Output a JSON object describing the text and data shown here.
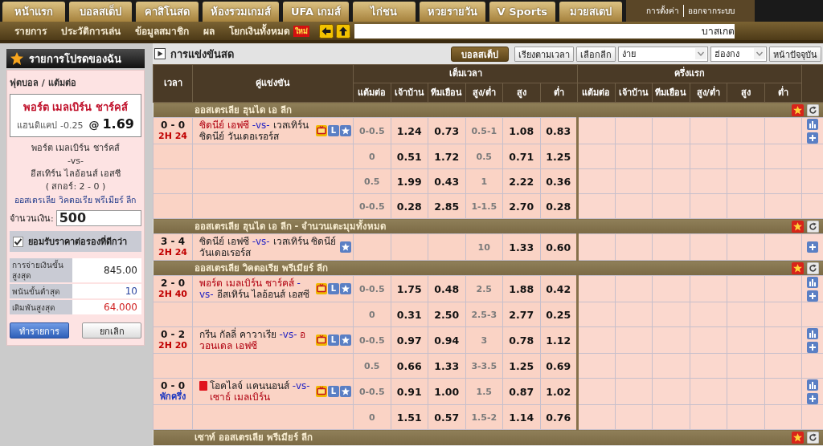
{
  "top_nav": {
    "tabs": [
      "หน้าแรก",
      "บอลสเต็ป",
      "คาสิโนสด",
      "ห้องรวมเกมส์",
      "UFA เกมส์",
      "ไก่ชน",
      "หวยรายวัน",
      "V Sports",
      "มวยสเตป"
    ],
    "account_links": [
      "การตั้งค่า",
      "ออกจากระบบ"
    ]
  },
  "sub_nav": {
    "links": [
      {
        "label": "รายการ"
      },
      {
        "label": "ประวัติการเล่น"
      },
      {
        "label": "ข้อมูลสมาชิก"
      },
      {
        "label": "ผล"
      },
      {
        "label": "โยกเงินทั้งหมด",
        "badge": "ใหม่"
      }
    ],
    "ticker": "บาสเกต"
  },
  "bet_slip": {
    "title": "รายการโปรดของฉัน",
    "sport": "ฟุตบอล / แต้มต่อ",
    "pick": {
      "team": "พอร์ต เมลเบิร์น ชาร์คส์",
      "market": "แฮนดิแคป",
      "line": "-0.25",
      "at": "@",
      "odds": "1.69"
    },
    "home": "พอร์ต เมลเบิร์น ชาร์คส์",
    "vs": "-vs-",
    "away": "อีสเทิร์น ไลอ้อนส์ เอสซี",
    "score": "( สกอร์: 2 - 0 )",
    "league": "ออสเตรเลีย วิคตอเรีย พรีเมียร์ ลีก",
    "amount": {
      "label": "จำนวนเงิน:",
      "value": "500"
    },
    "accept_better_odds": {
      "label": "ยอมรับราคาต่อรองที่ดีกว่า",
      "checked": true
    },
    "limits": [
      {
        "kind": "payout",
        "label": "การจ่ายเงินขั้นสูงสุด",
        "value": "845.00"
      },
      {
        "kind": "min",
        "label": "พนันขั้นต่ำสุด",
        "value": "10"
      },
      {
        "kind": "max",
        "label": "เดิมพันสูงสุด",
        "value": "64.000"
      }
    ],
    "buttons": [
      {
        "kind": "primary",
        "label": "ทำรายการ"
      },
      {
        "kind": "secondary",
        "label": "ยกเลิก"
      }
    ]
  },
  "live": {
    "title": "การแข่งขันสด",
    "toolbar": [
      {
        "kind": "toggle",
        "label": "บอลสเต็ป",
        "selected": true
      },
      {
        "kind": "button",
        "label": "เรียงตามเวลา"
      },
      {
        "kind": "button",
        "label": "เลือกลีก"
      },
      {
        "kind": "select",
        "value": "ง่าย"
      },
      {
        "kind": "select",
        "value": "ฮ่องกง"
      },
      {
        "kind": "button",
        "label": "หน้าปัจจุบัน"
      }
    ],
    "table": {
      "header": {
        "time": "เวลา",
        "match": "คู่แข่งขัน",
        "groups": [
          {
            "label": "เต็มเวลา",
            "columns": [
              "แต้มต่อ",
              "เจ้าบ้าน",
              "ทีมเยือน",
              "สูง/ต่ำ",
              "สูง",
              "ต่ำ"
            ]
          },
          {
            "label": "ครึ่งแรก",
            "columns": [
              "แต้มต่อ",
              "เจ้าบ้าน",
              "ทีมเยือน",
              "สูง/ต่ำ",
              "สูง",
              "ต่ำ"
            ]
          }
        ]
      },
      "leagues": [
        {
          "name": "ออสเตรเลีย ฮุนได เอ ลีก",
          "matches": [
            {
              "score": "0 - 0",
              "clock": {
                "kind": "running",
                "text": "2H 24"
              },
              "red_card": false,
              "home": {
                "name": "ซิดนีย์ เอฟซี",
                "favorite": true
              },
              "vs": "-vs-",
              "away": {
                "name": "เวสเทิร์น ซิดนีย์ วันเดอเรอร์ส",
                "favorite": false
              },
              "markers": [
                {
                  "kind": "tv"
                },
                {
                  "kind": "live",
                  "text": "L"
                },
                {
                  "kind": "star"
                }
              ],
              "lines": [
                {
                  "hdp": "0-0.5",
                  "odds_home": "1.24",
                  "odds_away": "0.73",
                  "ou": "0.5-1",
                  "over": "1.08",
                  "under": "0.83",
                  "tools": [
                    {
                      "kind": "stats"
                    },
                    {
                      "kind": "add"
                    }
                  ]
                },
                {
                  "hdp": "0",
                  "odds_home": "0.51",
                  "odds_away": "1.72",
                  "ou": "0.5",
                  "over": "0.71",
                  "under": "1.25"
                },
                {
                  "hdp": "0.5",
                  "odds_home": "1.99",
                  "odds_away": "0.43",
                  "ou": "1",
                  "over": "2.22",
                  "under": "0.36"
                },
                {
                  "hdp": "0-0.5",
                  "odds_home": "0.28",
                  "odds_away": "2.85",
                  "ou": "1-1.5",
                  "over": "2.70",
                  "under": "0.28"
                }
              ]
            }
          ]
        },
        {
          "name": "ออสเตรเลีย ฮุนได เอ ลีก - จำนวนเตะมุมทั้งหมด",
          "matches": [
            {
              "score": "3 - 4",
              "clock": {
                "kind": "running",
                "text": "2H 24"
              },
              "red_card": false,
              "home": {
                "name": "ซิดนีย์ เอฟซี",
                "favorite": false
              },
              "vs": "-vs-",
              "away": {
                "name": "เวสเทิร์น ซิดนีย์ วันเดอเรอร์ส",
                "favorite": false
              },
              "markers": [
                {
                  "kind": "star"
                }
              ],
              "lines": [
                {
                  "ou": "10",
                  "over": "1.33",
                  "under": "0.60",
                  "tools": [
                    {
                      "kind": "add"
                    }
                  ]
                }
              ]
            }
          ]
        },
        {
          "name": "ออสเตรเลีย วิคตอเรีย พรีเมียร์ ลีก",
          "matches": [
            {
              "score": "2 - 0",
              "clock": {
                "kind": "running",
                "text": "2H 40"
              },
              "red_card": false,
              "home": {
                "name": "พอร์ต เมลเบิร์น ชาร์คส์",
                "favorite": true
              },
              "vs": "-vs-",
              "away": {
                "name": "อีสเทิร์น ไลอ้อนส์ เอสซี",
                "favorite": false
              },
              "markers": [
                {
                  "kind": "tv"
                },
                {
                  "kind": "live",
                  "text": "L"
                },
                {
                  "kind": "star"
                }
              ],
              "lines": [
                {
                  "hdp": "0-0.5",
                  "odds_home": "1.75",
                  "odds_away": "0.48",
                  "ou": "2.5",
                  "over": "1.88",
                  "under": "0.42",
                  "tools": [
                    {
                      "kind": "stats"
                    },
                    {
                      "kind": "add"
                    }
                  ]
                },
                {
                  "hdp": "0",
                  "odds_home": "0.31",
                  "odds_away": "2.50",
                  "ou": "2.5-3",
                  "over": "2.77",
                  "under": "0.25"
                }
              ]
            },
            {
              "score": "0 - 2",
              "clock": {
                "kind": "running",
                "text": "2H 20"
              },
              "red_card": false,
              "home": {
                "name": "กรีน กัลลี่ คาวาเรีย",
                "favorite": false
              },
              "vs": "-vs-",
              "away": {
                "name": "อวอนเดล เอฟซี",
                "favorite": true
              },
              "markers": [
                {
                  "kind": "tv"
                },
                {
                  "kind": "live",
                  "text": "L"
                },
                {
                  "kind": "star"
                }
              ],
              "lines": [
                {
                  "hdp": "0-0.5",
                  "odds_home": "0.97",
                  "odds_away": "0.94",
                  "ou": "3",
                  "over": "0.78",
                  "under": "1.12",
                  "tools": [
                    {
                      "kind": "stats"
                    },
                    {
                      "kind": "add"
                    }
                  ]
                },
                {
                  "hdp": "0.5",
                  "odds_home": "0.66",
                  "odds_away": "1.33",
                  "ou": "3-3.5",
                  "over": "1.25",
                  "under": "0.69"
                }
              ]
            },
            {
              "score": "0 - 0",
              "clock": {
                "kind": "break",
                "text": "พักครึ่ง"
              },
              "red_card": true,
              "home": {
                "name": "โอคไลจ์ แคนนอนส์",
                "favorite": false
              },
              "vs": "-vs-",
              "away": {
                "name": "เซาธ์ เมลเบิร์น",
                "favorite": true
              },
              "markers": [
                {
                  "kind": "tv"
                },
                {
                  "kind": "live",
                  "text": "L"
                },
                {
                  "kind": "star"
                }
              ],
              "lines": [
                {
                  "hdp": "0-0.5",
                  "odds_home": "0.91",
                  "odds_away": "1.00",
                  "ou": "1.5",
                  "over": "0.87",
                  "under": "1.02",
                  "tools": [
                    {
                      "kind": "stats"
                    },
                    {
                      "kind": "add"
                    }
                  ]
                },
                {
                  "hdp": "0",
                  "odds_home": "1.51",
                  "odds_away": "0.57",
                  "ou": "1.5-2",
                  "over": "1.14",
                  "under": "0.76"
                }
              ]
            }
          ]
        },
        {
          "name": "เซาท์ ออสเตรเลีย พรีเมียร์ ลีก"
        }
      ]
    }
  }
}
